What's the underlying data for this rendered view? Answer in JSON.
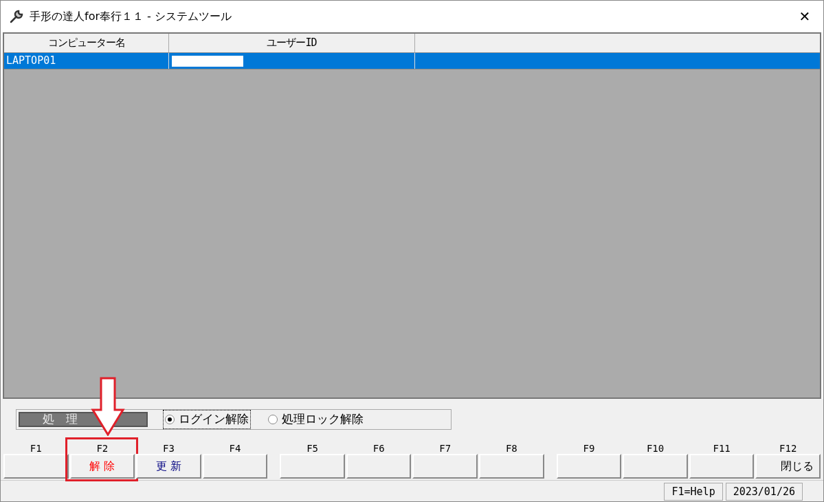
{
  "window": {
    "title": "手形の達人for奉行１１ - システムツール",
    "close": "✕"
  },
  "table": {
    "columns": [
      "コンピューター名",
      "ユーザーID"
    ],
    "rows": [
      {
        "cells": [
          "LAPTOP01"
        ],
        "selected": true,
        "redacted_user": true
      }
    ]
  },
  "options": {
    "label": "処 理",
    "radios": [
      {
        "label": "ログイン解除",
        "selected": true
      },
      {
        "label": "処理ロック解除",
        "selected": false
      }
    ]
  },
  "function_keys": [
    {
      "key": "F1",
      "highlighted": false
    },
    {
      "key": "F2",
      "label": "解 除",
      "color": "#ff0000",
      "highlighted": true
    },
    {
      "key": "F3",
      "label": "更 新",
      "color": "#000080",
      "highlighted": false
    },
    {
      "key": "F4",
      "highlighted": false
    },
    {
      "key": "F5",
      "highlighted": false
    },
    {
      "key": "F6",
      "highlighted": false
    },
    {
      "key": "F7",
      "highlighted": false
    },
    {
      "key": "F8",
      "highlighted": false
    },
    {
      "key": "F9",
      "highlighted": false
    },
    {
      "key": "F10",
      "highlighted": false
    },
    {
      "key": "F11",
      "highlighted": false
    },
    {
      "key": "F12",
      "label": "閉じる",
      "color": "#000000",
      "highlighted": false
    }
  ],
  "status_bar": [
    "F1=Help",
    "2023/01/26"
  ]
}
